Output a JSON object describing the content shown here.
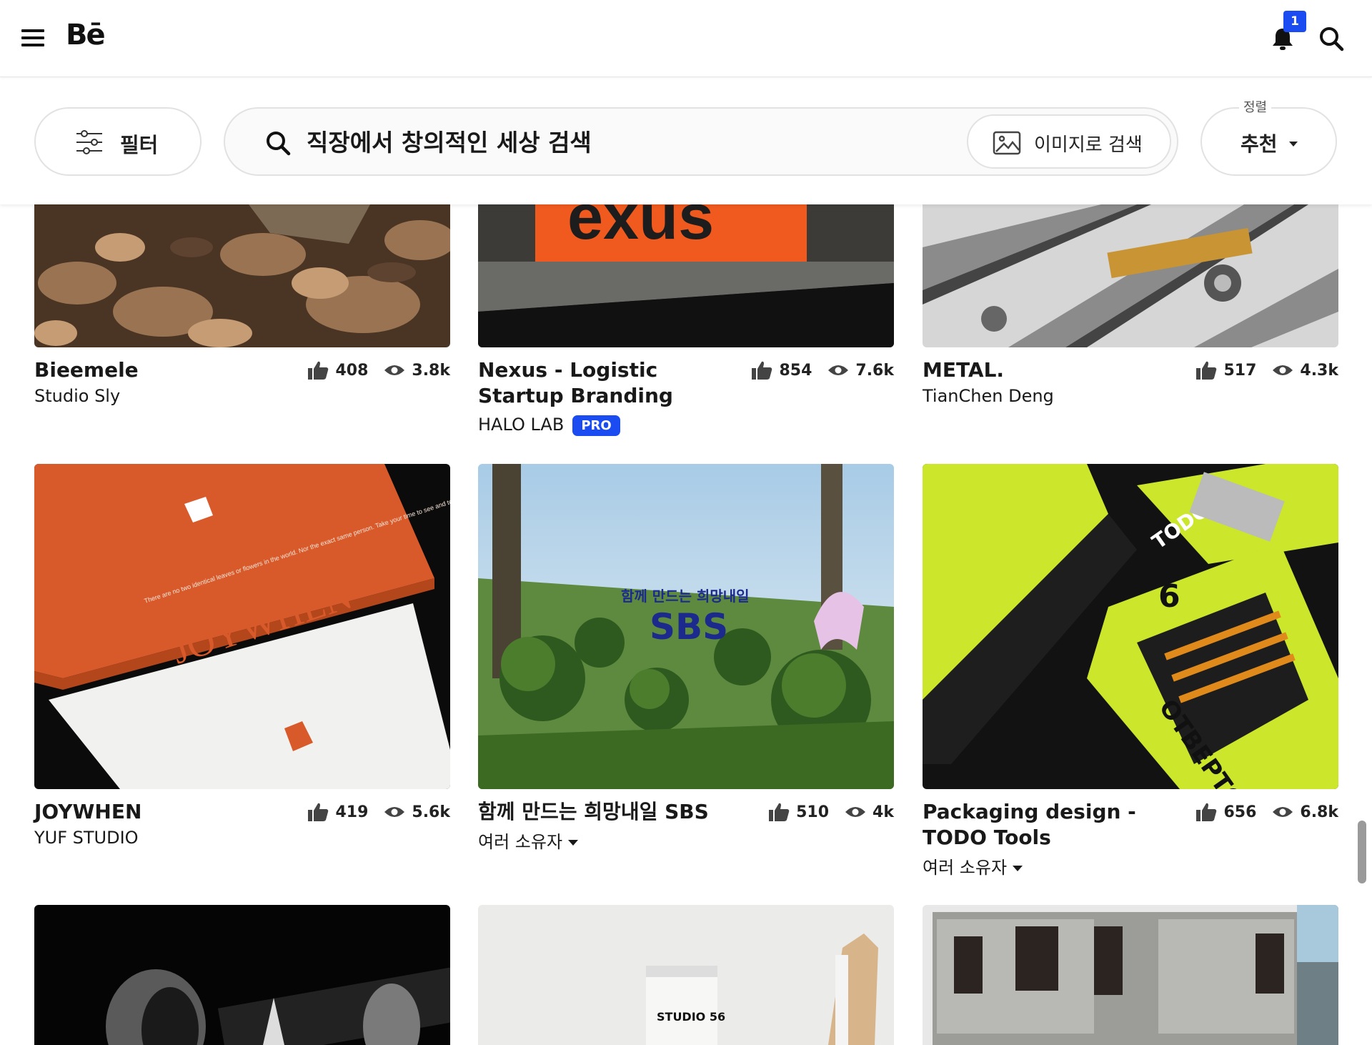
{
  "header": {
    "logo": "Bē",
    "notification_count": "1"
  },
  "filterbar": {
    "filter_label": "필터",
    "search_placeholder": "직장에서 창의적인 세상 검색",
    "image_search_label": "이미지로 검색",
    "sort_caption": "정렬",
    "sort_value": "추천"
  },
  "projects": [
    {
      "title": "Bieemele",
      "owner": "Studio Sly",
      "likes": "408",
      "views": "3.8k"
    },
    {
      "title": "Nexus - Logistic Startup Branding",
      "owner": "HALO LAB",
      "badge": "PRO",
      "likes": "854",
      "views": "7.6k"
    },
    {
      "title": "METAL.",
      "owner": "TianChen Deng",
      "likes": "517",
      "views": "4.3k"
    },
    {
      "title": "JOYWHEN",
      "owner": "YUF STUDIO",
      "likes": "419",
      "views": "5.6k"
    },
    {
      "title": "함께 만드는 희망내일 SBS",
      "owner": "여러 소유자",
      "likes": "510",
      "views": "4k"
    },
    {
      "title": "Packaging design - TODO Tools",
      "owner": "여러 소유자",
      "likes": "656",
      "views": "6.8k"
    }
  ],
  "thumb_text": {
    "nexus": "exus",
    "joywhen": "JOYWHEN",
    "joywhen_small": "There are no two identical leaves or flowers in the world. Nor the exact same person. Take your time to see and to feel it gently.",
    "sbs_tagline": "함께 만드는 희망내일",
    "sbs_logo": "SBS",
    "todo_logo": "TODO",
    "todo_count": "6",
    "todo_side": "ОТВЕРТОК",
    "studio": "STUDIO 56"
  },
  "colors": {
    "accent": "#1a4cf2",
    "nexus_orange": "#f05a1e",
    "joywhen_orange": "#d85a2a",
    "todo_green": "#cbe62b",
    "sbs_blue": "#1b2a8c"
  }
}
